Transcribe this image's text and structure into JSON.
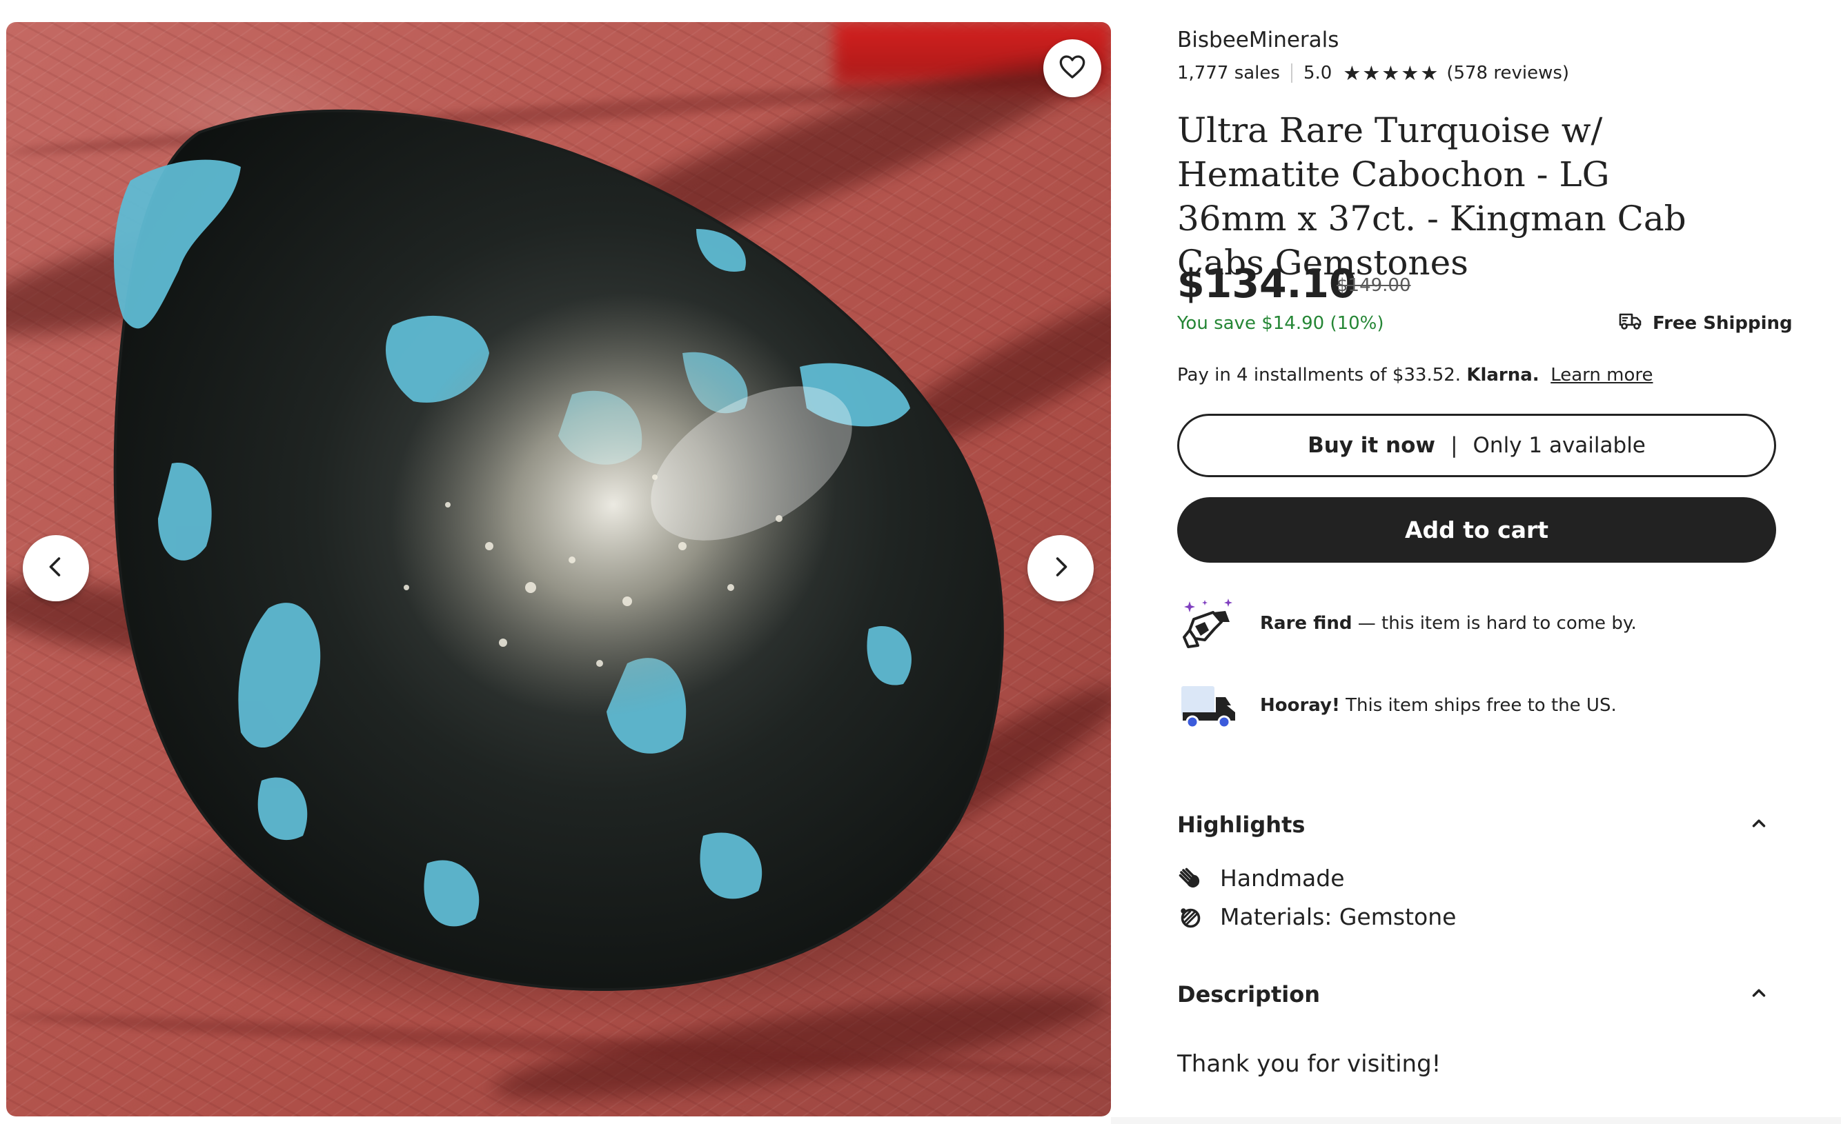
{
  "shop": {
    "name": "BisbeeMinerals",
    "sales": "1,777 sales",
    "rating": "5.0",
    "stars": 5,
    "reviews": "(578 reviews)"
  },
  "listing": {
    "title": "Ultra Rare Turquoise w/ Hematite Cabochon - LG 36mm x 37ct. - Kingman Cab Cabs Gemstones",
    "price": "$134.10",
    "original_price": "$149.00",
    "savings": "You save $14.90 (10%)",
    "free_shipping": "Free Shipping"
  },
  "klarna": {
    "text": "Pay in 4 installments of $33.52. ",
    "brand": "Klarna.",
    "link": "Learn more"
  },
  "actions": {
    "buy_now": "Buy it now",
    "separator": "|",
    "availability": "Only 1 available",
    "add_to_cart": "Add to cart"
  },
  "features": [
    {
      "icon": "rare-find-icon",
      "bold": "Rare find",
      "text": " — this item is hard to come by."
    },
    {
      "icon": "delivery-truck-icon",
      "bold": "Hooray!",
      "text": " This item ships free to the US."
    }
  ],
  "highlights": {
    "title": "Highlights",
    "items": [
      {
        "icon": "handmade-hand-icon",
        "label": "Handmade"
      },
      {
        "icon": "materials-icon",
        "label": "Materials: Gemstone"
      }
    ]
  },
  "description": {
    "title": "Description",
    "text": "Thank you for visiting!"
  },
  "colors": {
    "primary_text": "#222222",
    "savings_green": "#258635",
    "button_dark": "#222222",
    "accent_purple": "#7f3fbf",
    "truck_blue": "#3b5bdb"
  }
}
